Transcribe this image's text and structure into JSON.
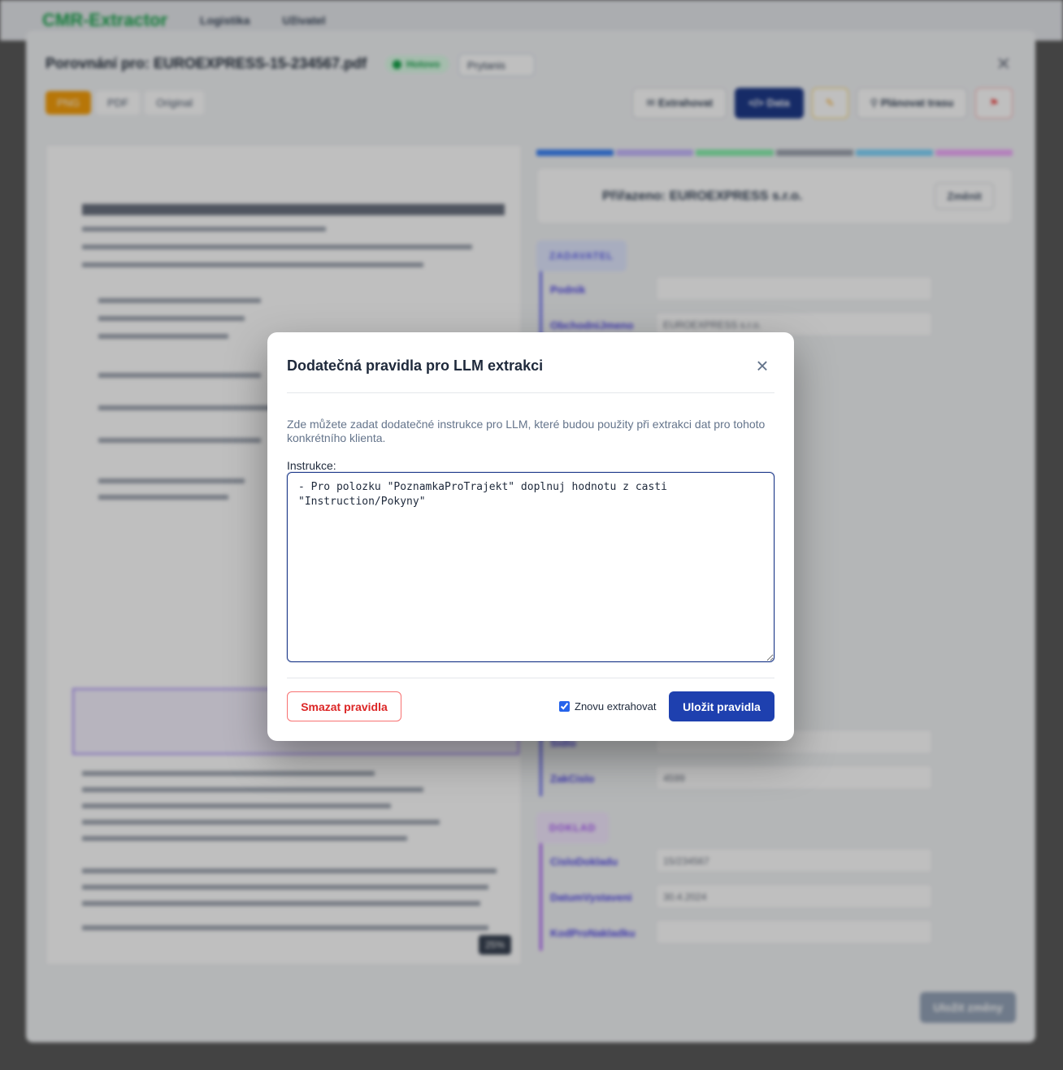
{
  "app": {
    "brand": "CMR-Extractor",
    "nav_logistika": "Logistika",
    "nav_uzivatel": "Uživatel"
  },
  "panel": {
    "title": "Porovnání pro: EUROEXPRESS-15-234567.pdf",
    "status": "Hotovo",
    "select_value": "Prytanis",
    "tabs": [
      "PNG",
      "PDF",
      "Original"
    ],
    "toolbar": {
      "extract": "Extrahovat",
      "data": "Data",
      "plan_route": "Plánovat trasu"
    },
    "zoom": "25%",
    "save_changes": "Uložit změny"
  },
  "right_panel": {
    "assigned_label": "Přiřazeno: EUROEXPRESS s.r.o.",
    "change_button": "Změnit",
    "section_zadavatel": "ZADAVATEL",
    "section_doklad": "DOKLAD",
    "fields": [
      {
        "label": "Podnik",
        "value": ""
      },
      {
        "label": "ObchodniJmeno",
        "value": "EUROEXPRESS s.r.o."
      },
      {
        "label": "Sidlo",
        "value": ""
      },
      {
        "label": "ZakCislo",
        "value": "4599"
      }
    ],
    "doklad_fields": [
      {
        "label": "CisloDokladu",
        "value": "15/234567"
      },
      {
        "label": "DatumVystaveni",
        "value": "30.4.2024"
      },
      {
        "label": "KodProNakladku",
        "value": ""
      }
    ]
  },
  "modal": {
    "title": "Dodatečná pravidla pro LLM extrakci",
    "description": "Zde můžete zadat dodatečné instrukce pro LLM, které budou použity při extrakci dat pro tohoto konkrétního klienta.",
    "instructions_label": "Instrukce:",
    "instructions_value": "- Pro polozku \"PoznamkaProTrajekt\" doplnuj hodnotu z casti \"Instruction/Pokyny\"",
    "clear_button": "Smazat pravidla",
    "reextract_label": "Znovu extrahovat",
    "reextract_checked": true,
    "save_button": "Uložit pravidla"
  },
  "colors": {
    "primary": "#1e40af",
    "danger": "#dc2626",
    "accent_orange": "#f59e0b",
    "success": "#16a34a"
  }
}
